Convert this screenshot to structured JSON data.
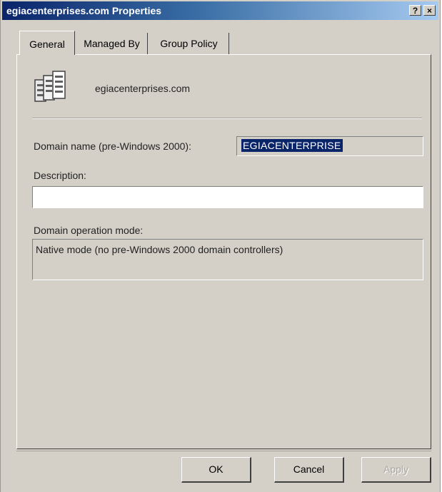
{
  "window": {
    "title": "egiacenterprises.com Properties"
  },
  "title_buttons": {
    "help": "?",
    "close": "×"
  },
  "tabs": [
    {
      "label": "General",
      "active": true
    },
    {
      "label": "Managed By",
      "active": false
    },
    {
      "label": "Group Policy",
      "active": false
    }
  ],
  "general": {
    "icon": "domain-servers-icon",
    "domain_name": "egiacenterprises.com",
    "pre_windows_label": "Domain name (pre-Windows 2000):",
    "pre_windows_value": "EGIACENTERPRISE",
    "description_label": "Description:",
    "description_value": "",
    "mode_label": "Domain operation mode:",
    "mode_value": "Native mode (no pre-Windows 2000 domain controllers)"
  },
  "buttons": {
    "ok": "OK",
    "cancel": "Cancel",
    "apply": "Apply"
  },
  "colors": {
    "title_start": "#0a246a",
    "title_end": "#a6caf0",
    "face": "#d4d0c8",
    "selection": "#0a246a"
  }
}
